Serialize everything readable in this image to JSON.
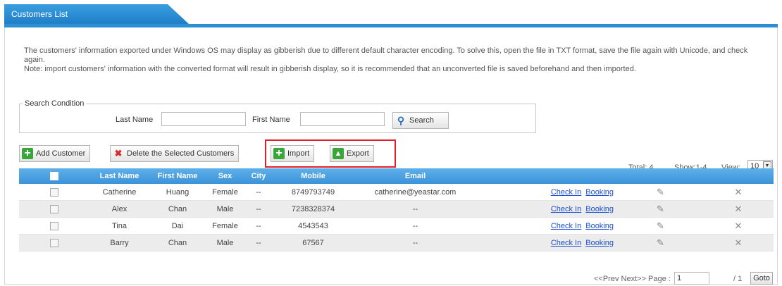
{
  "panel": {
    "tab_title": "Customers List"
  },
  "notice": {
    "line1": "The customers' information exported under Windows OS may display as gibberish due to different default character encoding. To solve this, open the file in TXT format, save the file again with Unicode, and check again.",
    "line2": "Note: import customers' information with the converted format will result in gibberish display, so it is recommended that an unconverted file is saved beforehand and then imported."
  },
  "search": {
    "legend": "Search Condition",
    "last_name_label": "Last Name",
    "last_name_value": "",
    "first_name_label": "First Name",
    "first_name_value": "",
    "search_button": "Search"
  },
  "toolbar": {
    "add_customer": "Add Customer",
    "delete_selected": "Delete the Selected Customers",
    "import": "Import",
    "export": "Export",
    "total": "Total: 4",
    "show": "Show:1-4",
    "view_label": "View:",
    "view_value": "10"
  },
  "table": {
    "headers": [
      "Last Name",
      "First Name",
      "Sex",
      "City",
      "Mobile",
      "Email"
    ],
    "actions": {
      "check_in": "Check In",
      "booking": "Booking"
    },
    "rows": [
      {
        "last": "Catherine",
        "first": "Huang",
        "sex": "Female",
        "city": "--",
        "mobile": "8749793749",
        "email": "catherine@yeastar.com"
      },
      {
        "last": "Alex",
        "first": "Chan",
        "sex": "Male",
        "city": "--",
        "mobile": "7238328374",
        "email": "--"
      },
      {
        "last": "Tina",
        "first": "Dai",
        "sex": "Female",
        "city": "--",
        "mobile": "4543543",
        "email": "--"
      },
      {
        "last": "Barry",
        "first": "Chan",
        "sex": "Male",
        "city": "--",
        "mobile": "67567",
        "email": "--"
      }
    ]
  },
  "pagination": {
    "nav": "<<Prev Next>> Page :",
    "page_value": "1",
    "total_pages": "/ 1",
    "goto": "Goto"
  },
  "icons": {
    "add": "plus-icon",
    "delete": "delete-icon",
    "import": "import-icon",
    "export": "export-icon",
    "search": "search-icon",
    "edit": "pencil-icon",
    "remove": "close-icon"
  },
  "colors": {
    "accent": "#2b8fd6",
    "header": "#4aa0e0",
    "highlight": "#e0212b",
    "link": "#1a4fd0"
  }
}
